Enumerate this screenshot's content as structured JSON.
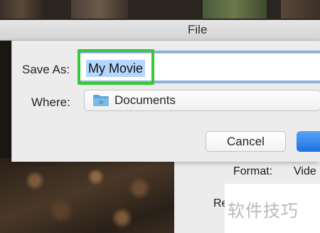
{
  "window": {
    "title": "File"
  },
  "save_dialog": {
    "save_as_label": "Save As:",
    "filename_value": "My Movie",
    "where_label": "Where:",
    "where_value": "Documents",
    "cancel_label": "Cancel",
    "save_label": ""
  },
  "info_panel": {
    "format_label": "Format:",
    "format_value": "Vide",
    "partial_label": "Re"
  },
  "watermark": {
    "text": "软件技巧"
  },
  "colors": {
    "accent_blue": "#1e6fdd",
    "highlight_green": "#37c837",
    "selection": "#b3d7ff"
  },
  "icons": {
    "where_icon": "folder-icon"
  }
}
